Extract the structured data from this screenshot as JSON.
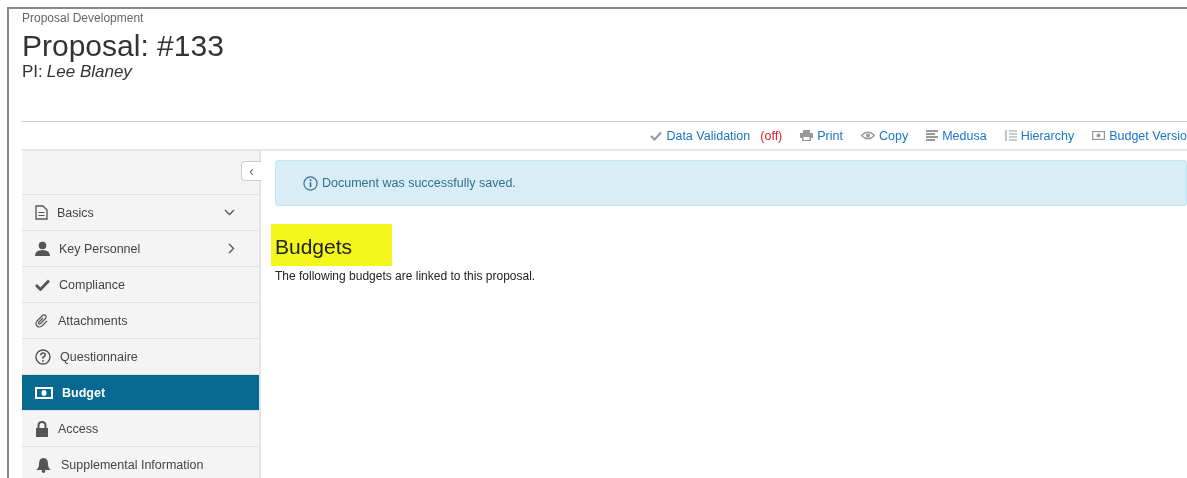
{
  "header": {
    "breadcrumb": "Proposal Development",
    "title": "Proposal: #133",
    "pi_label": "PI:",
    "pi_name": "Lee Blaney"
  },
  "toolbar": [
    {
      "label": "Data Validation",
      "status": "(off)"
    },
    {
      "label": "Print"
    },
    {
      "label": "Copy"
    },
    {
      "label": "Medusa"
    },
    {
      "label": "Hierarchy"
    },
    {
      "label": "Budget Versio"
    }
  ],
  "sidebar": {
    "collapse_glyph": "‹",
    "items": [
      {
        "label": "Basics",
        "kind": "group",
        "expanded": true,
        "selected": false
      },
      {
        "label": "Key Personnel",
        "kind": "group",
        "expanded": false,
        "selected": false
      },
      {
        "label": "Compliance",
        "kind": "page",
        "selected": false
      },
      {
        "label": "Attachments",
        "kind": "page",
        "selected": false
      },
      {
        "label": "Questionnaire",
        "kind": "page",
        "selected": false
      },
      {
        "label": "Budget",
        "kind": "page",
        "selected": true
      },
      {
        "label": "Access",
        "kind": "page",
        "selected": false
      },
      {
        "label": "Supplemental Information",
        "kind": "page",
        "selected": false
      }
    ]
  },
  "alert": {
    "message": "Document was successfully saved."
  },
  "content": {
    "heading": "Budgets",
    "text": "The following budgets are linked to this proposal."
  }
}
